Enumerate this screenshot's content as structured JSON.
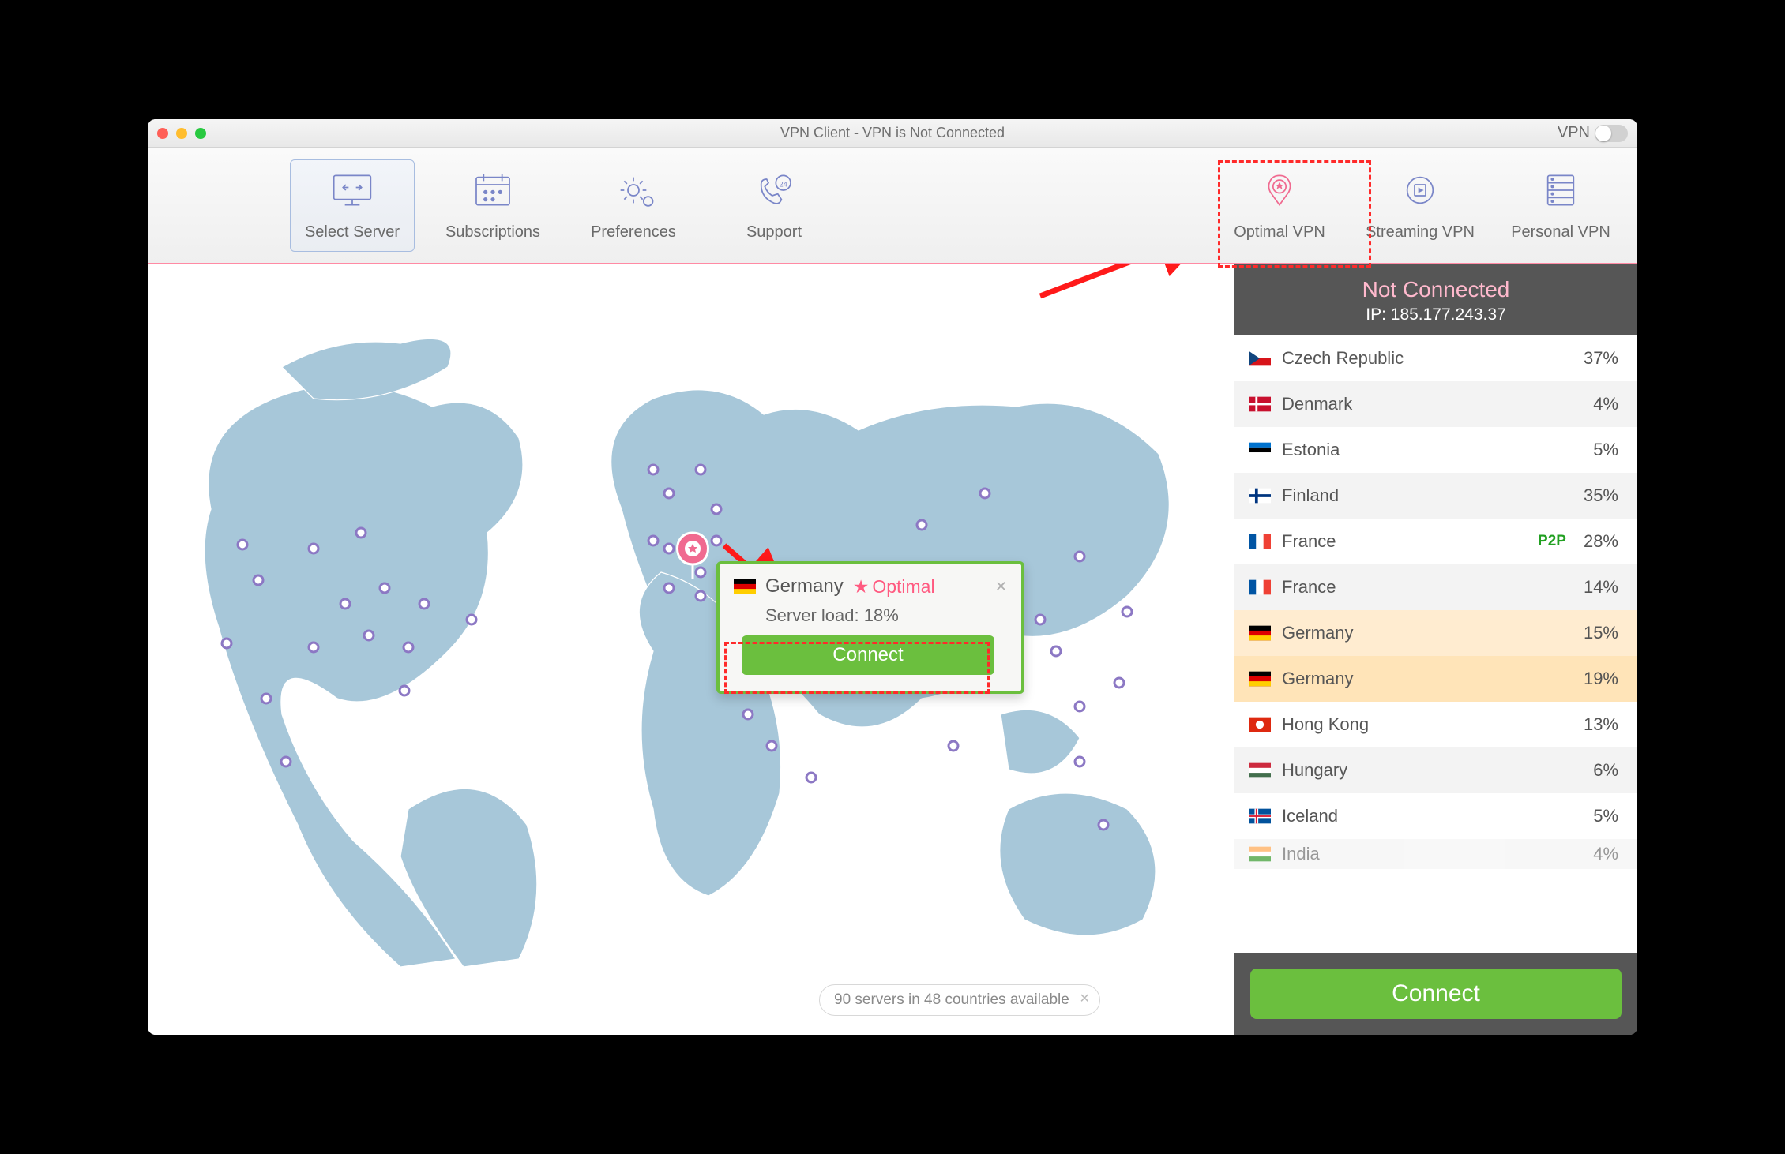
{
  "window": {
    "title": "VPN Client - VPN is Not Connected",
    "vpn_label": "VPN"
  },
  "toolbar": {
    "items": [
      {
        "label": "Select Server",
        "icon": "monitor-arrows-icon",
        "selected": true
      },
      {
        "label": "Subscriptions",
        "icon": "calendar-icon"
      },
      {
        "label": "Preferences",
        "icon": "gear-icon"
      },
      {
        "label": "Support",
        "icon": "phone-24-icon"
      }
    ],
    "right_items": [
      {
        "label": "Optimal VPN",
        "icon": "pin-star-icon",
        "pink": true
      },
      {
        "label": "Streaming VPN",
        "icon": "play-circle-icon"
      },
      {
        "label": "Personal VPN",
        "icon": "server-rack-icon"
      }
    ]
  },
  "popup": {
    "country": "Germany",
    "tag": "Optimal",
    "load_label": "Server load:",
    "load_value": "18%",
    "connect_label": "Connect"
  },
  "pill": {
    "text": "90 servers in 48 countries available"
  },
  "sidebar": {
    "status": "Not Connected",
    "ip_label": "IP: 185.177.243.37",
    "connect_label": "Connect",
    "servers": [
      {
        "name": "Czech Republic",
        "load": "37%",
        "flag": "cz"
      },
      {
        "name": "Denmark",
        "load": "4%",
        "flag": "dk"
      },
      {
        "name": "Estonia",
        "load": "5%",
        "flag": "ee"
      },
      {
        "name": "Finland",
        "load": "35%",
        "flag": "fi"
      },
      {
        "name": "France",
        "load": "28%",
        "flag": "fr",
        "p2p": "P2P"
      },
      {
        "name": "France",
        "load": "14%",
        "flag": "fr"
      },
      {
        "name": "Germany",
        "load": "15%",
        "flag": "de",
        "hl": 1
      },
      {
        "name": "Germany",
        "load": "19%",
        "flag": "de",
        "hl": 2
      },
      {
        "name": "Hong Kong",
        "load": "13%",
        "flag": "hk"
      },
      {
        "name": "Hungary",
        "load": "6%",
        "flag": "hu"
      },
      {
        "name": "Iceland",
        "load": "5%",
        "flag": "is"
      },
      {
        "name": "India",
        "load": "4%",
        "flag": "in",
        "partial": true
      }
    ]
  }
}
